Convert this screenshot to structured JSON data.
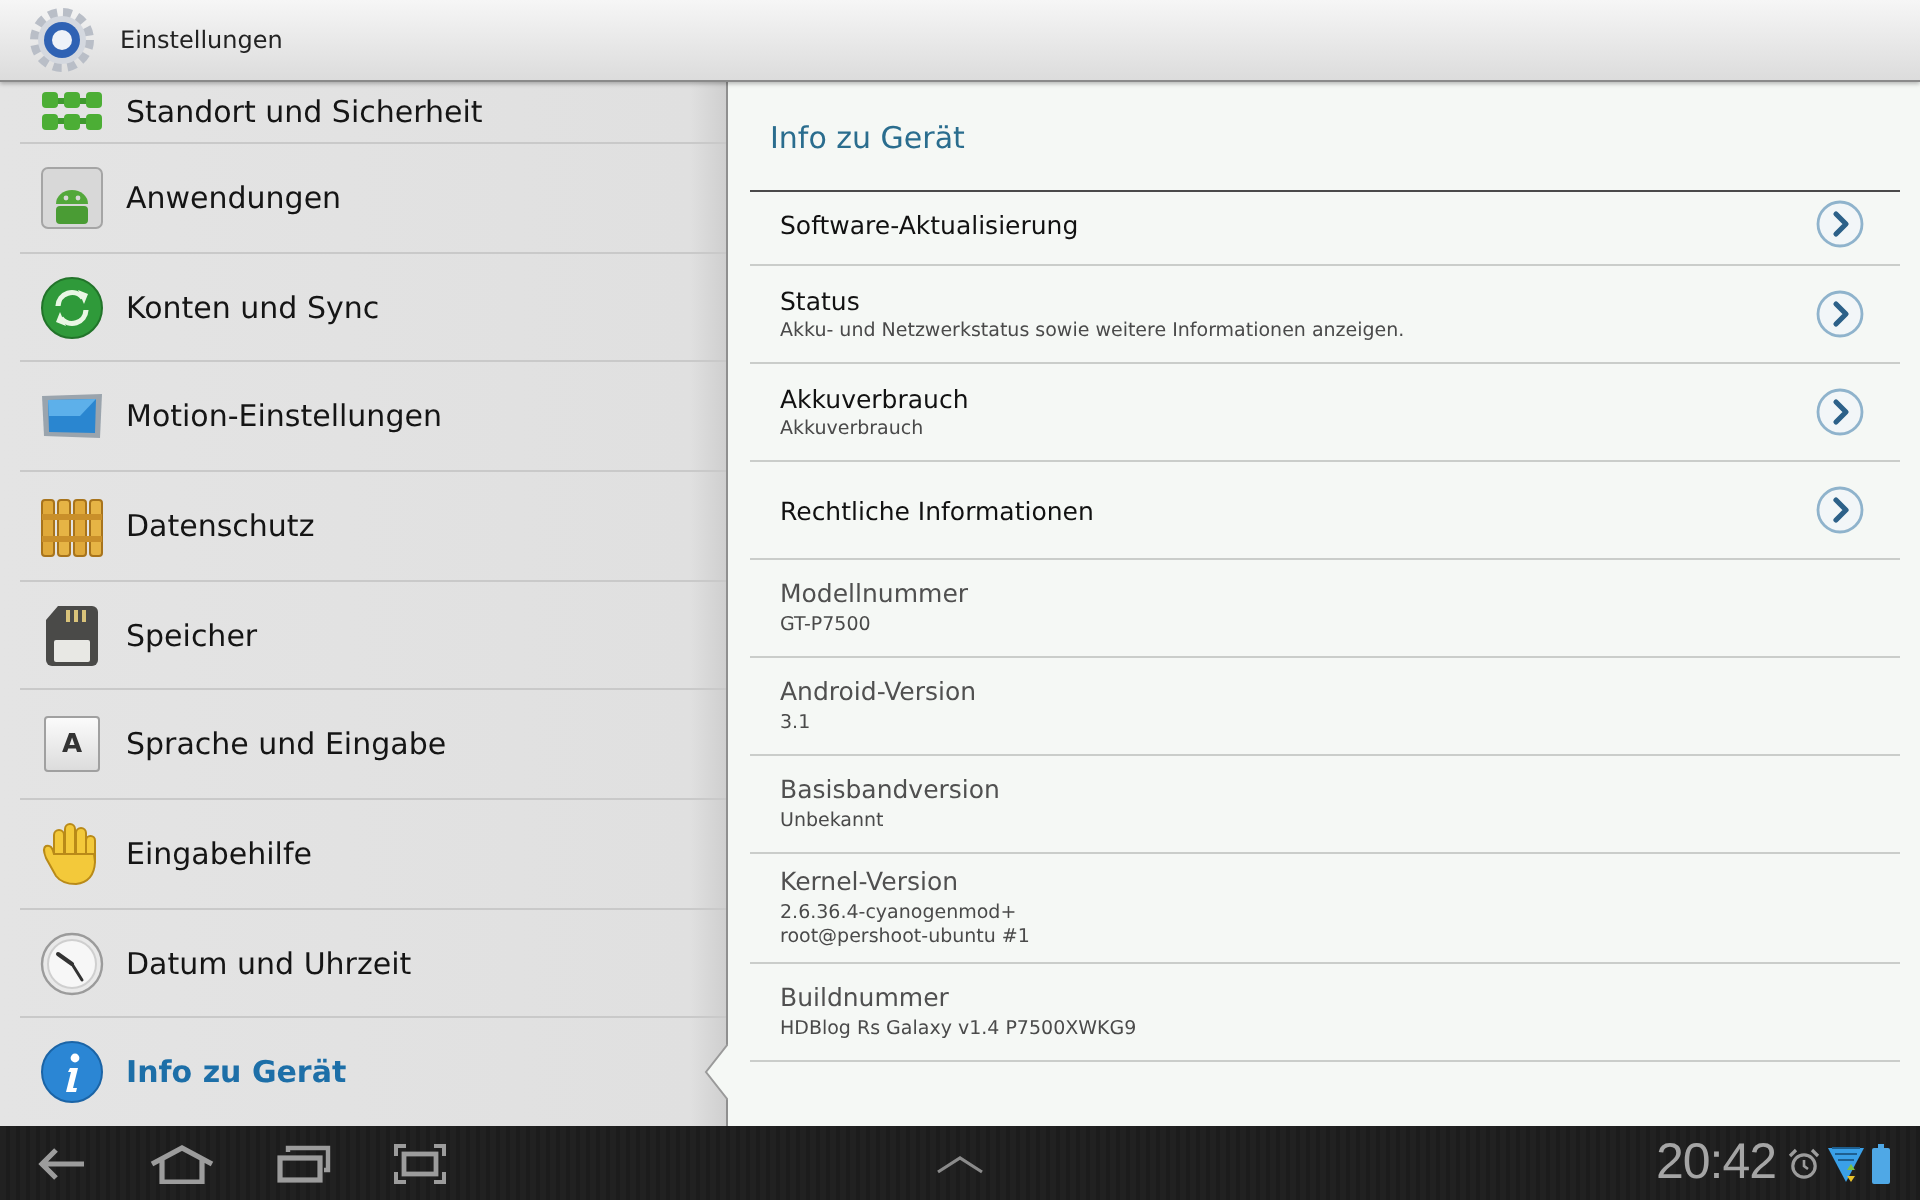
{
  "title_bar": {
    "title": "Einstellungen"
  },
  "sidebar": {
    "items": [
      {
        "label": "Standort und Sicherheit",
        "selected": false
      },
      {
        "label": "Anwendungen",
        "selected": false
      },
      {
        "label": "Konten und Sync",
        "selected": false
      },
      {
        "label": "Motion-Einstellungen",
        "selected": false
      },
      {
        "label": "Datenschutz",
        "selected": false
      },
      {
        "label": "Speicher",
        "selected": false
      },
      {
        "label": "Sprache und Eingabe",
        "selected": false,
        "icon_text": "A"
      },
      {
        "label": "Eingabehilfe",
        "selected": false
      },
      {
        "label": "Datum und Uhrzeit",
        "selected": false
      },
      {
        "label": "Info zu Gerät",
        "selected": true
      }
    ]
  },
  "detail": {
    "title": "Info zu Gerät",
    "items": [
      {
        "kind": "link",
        "title": "Software-Aktualisierung"
      },
      {
        "kind": "link",
        "title": "Status",
        "summary": "Akku- und Netzwerkstatus sowie weitere Informationen anzeigen."
      },
      {
        "kind": "link",
        "title": "Akkuverbrauch",
        "summary": "Akkuverbrauch"
      },
      {
        "kind": "link",
        "title": "Rechtliche Informationen"
      },
      {
        "kind": "info",
        "title": "Modellnummer",
        "summary": "GT-P7500"
      },
      {
        "kind": "info",
        "title": "Android-Version",
        "summary": "3.1"
      },
      {
        "kind": "info",
        "title": "Basisbandversion",
        "summary": "Unbekannt"
      },
      {
        "kind": "info",
        "title": "Kernel-Version",
        "summary": "2.6.36.4-cyanogenmod+\nroot@pershoot-ubuntu #1"
      },
      {
        "kind": "info",
        "title": "Buildnummer",
        "summary": "HDBlog Rs Galaxy v1.4 P7500XWKG9"
      }
    ]
  },
  "status_bar": {
    "time": "20:42"
  }
}
